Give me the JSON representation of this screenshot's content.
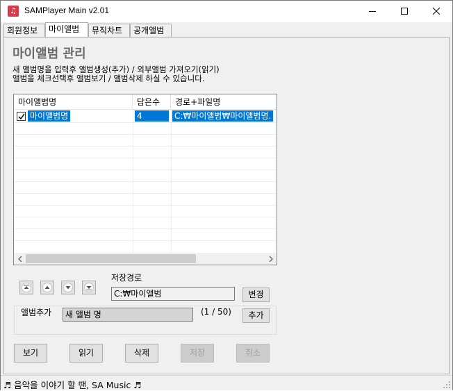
{
  "window": {
    "title": "SAMPlayer Main v2.01",
    "app_icon": "music-note-icon"
  },
  "tabs": [
    {
      "label": "회원정보",
      "active": false
    },
    {
      "label": "마이앨범",
      "active": true
    },
    {
      "label": "뮤직차트",
      "active": false
    },
    {
      "label": "공개앨범",
      "active": false
    }
  ],
  "page": {
    "title": "마이앨범 관리",
    "desc_line1": "새 앨범명을 입력후 앨범생성(추가) / 외부앨범 가져오기(읽기)",
    "desc_line2": "앨범을 체크선택후 앨범보기 / 앨범삭제 하실 수 있습니다."
  },
  "album_list": {
    "columns": [
      "마이앨범명",
      "담은수",
      "경로+파일명"
    ],
    "rows": [
      {
        "checked": true,
        "selected": true,
        "name": "마이앨범명",
        "count": "4",
        "path": "C:₩마이앨범₩마이앨범명."
      }
    ]
  },
  "storage": {
    "label": "저장경로",
    "path": "C:₩마이앨범",
    "change_label": "변경"
  },
  "add_album": {
    "label": "앨범추가",
    "value": "새 앨범 명",
    "counter": "(1 / 50)",
    "add_label": "추가"
  },
  "actions": {
    "view": "보기",
    "read": "읽기",
    "delete": "삭제",
    "save": "저장",
    "cancel": "취소"
  },
  "status": {
    "text": "♬ 음악을 이야기 할 땐, SA Music ♬"
  },
  "colors": {
    "selection": "#0078d7",
    "title_gray": "#6a6a6a",
    "app_icon": "#d93848"
  }
}
